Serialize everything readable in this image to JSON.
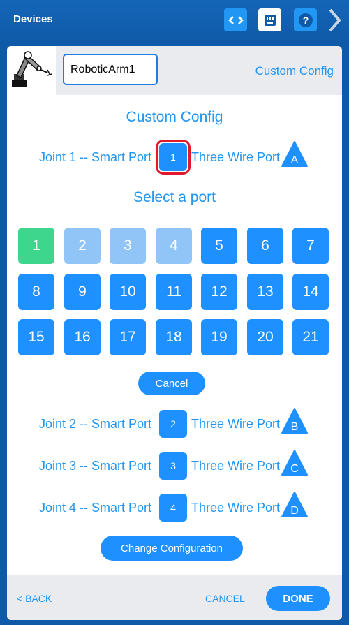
{
  "header": {
    "title": "Devices"
  },
  "device": {
    "name": "RoboticArm1",
    "config_link": "Custom Config"
  },
  "custom_config_title": "Custom Config",
  "select_title": "Select a port",
  "joints": [
    {
      "label": "Joint 1 -- Smart Port",
      "port": "1",
      "wire_label": "Three Wire Port",
      "wire_port": "A"
    },
    {
      "label": "Joint 2 -- Smart Port",
      "port": "2",
      "wire_label": "Three Wire Port",
      "wire_port": "B"
    },
    {
      "label": "Joint 3 -- Smart Port",
      "port": "3",
      "wire_label": "Three Wire Port",
      "wire_port": "C"
    },
    {
      "label": "Joint 4 -- Smart Port",
      "port": "4",
      "wire_label": "Three Wire Port",
      "wire_port": "D"
    }
  ],
  "ports": [
    "1",
    "2",
    "3",
    "4",
    "5",
    "6",
    "7",
    "8",
    "9",
    "10",
    "11",
    "12",
    "13",
    "14",
    "15",
    "16",
    "17",
    "18",
    "19",
    "20",
    "21"
  ],
  "port_state": {
    "selected": "1",
    "unavailable": [
      "2",
      "3",
      "4"
    ]
  },
  "cancel_label": "Cancel",
  "change_label": "Change Configuration",
  "footer": {
    "back": "< BACK",
    "cancel": "CANCEL",
    "done": "DONE"
  },
  "colors": {
    "accent": "#1e90ff",
    "selected": "#3dd68c",
    "unavailable": "#91c5f7",
    "highlight": "#e0192d"
  },
  "icons": [
    "code-icon",
    "port-icon",
    "help-icon",
    "chevron-right-icon",
    "robotic-arm-icon"
  ]
}
